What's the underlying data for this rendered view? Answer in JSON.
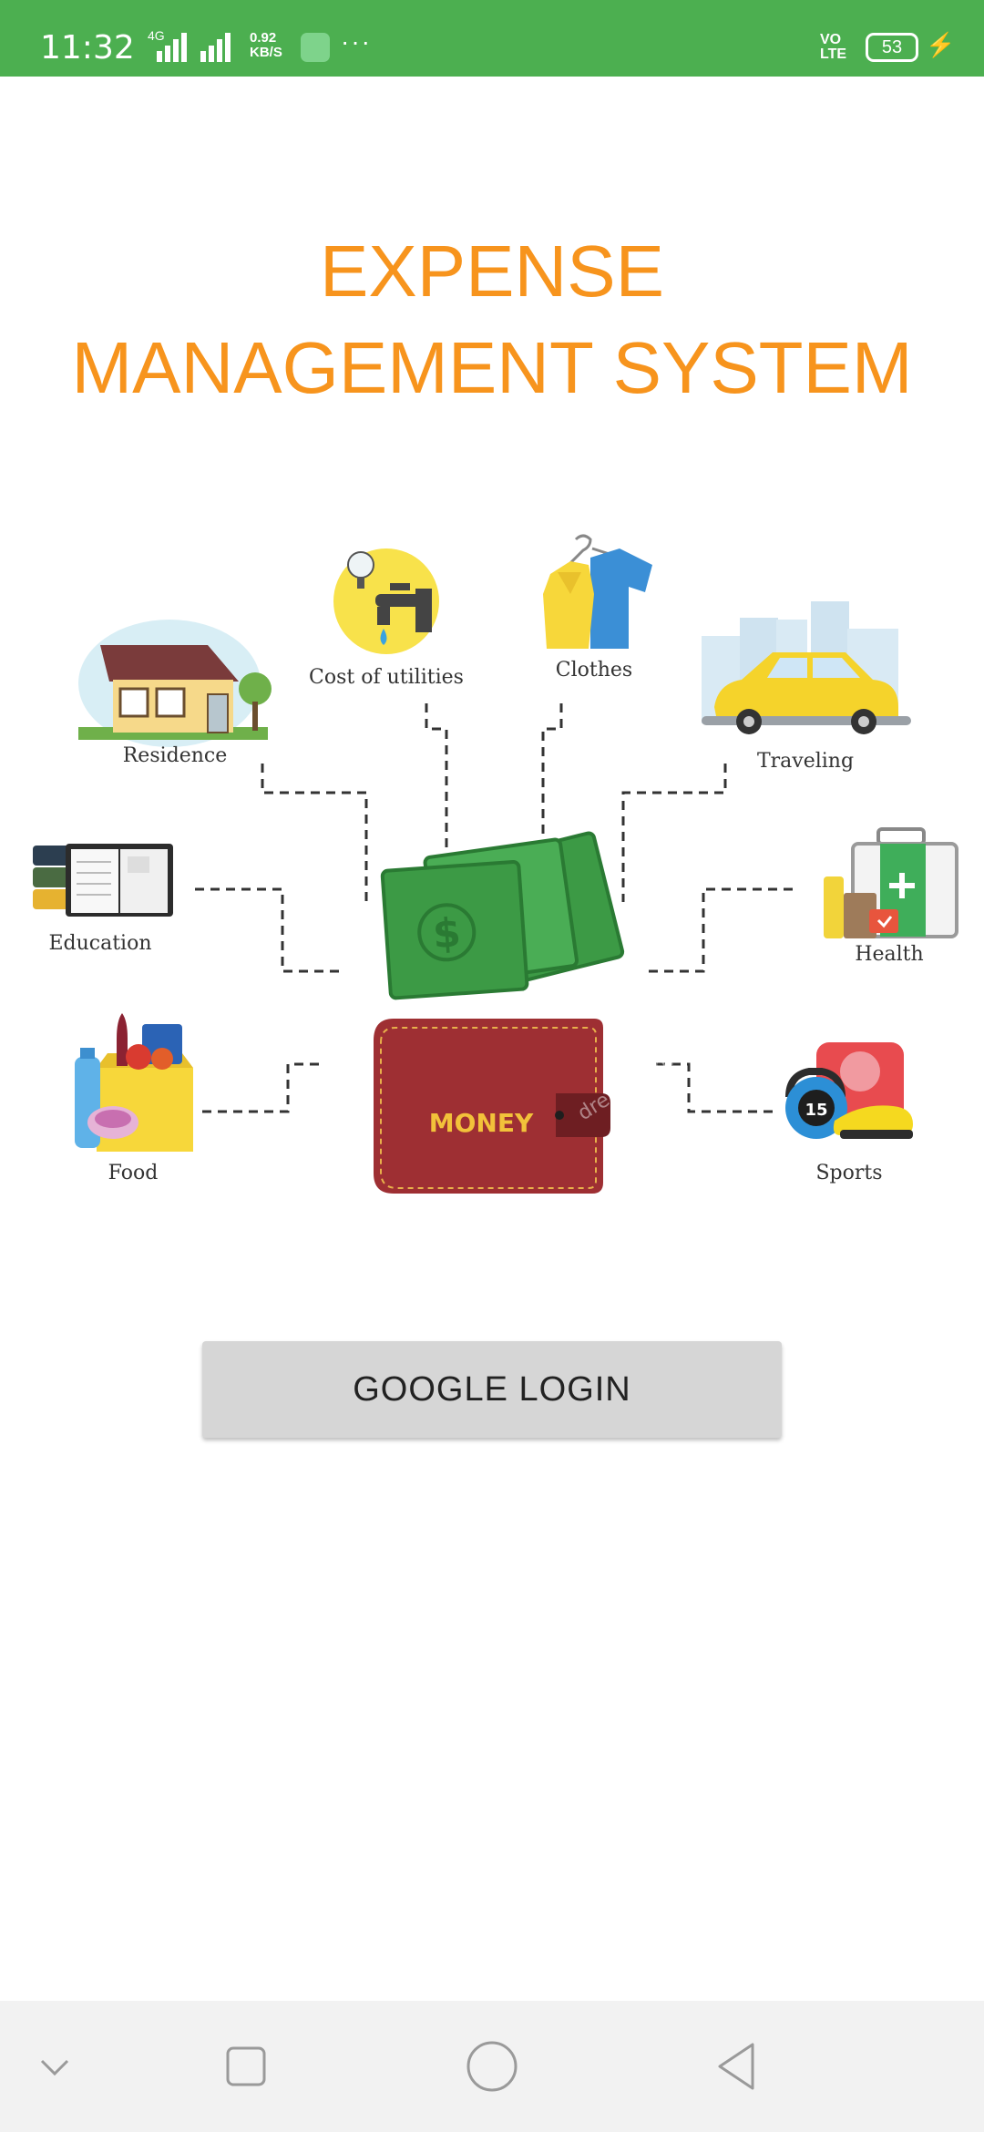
{
  "status_bar": {
    "time": "11:32",
    "network": "4G",
    "speed_value": "0.92",
    "speed_unit": "KB/S",
    "more": "···",
    "volte_1": "VO",
    "volte_2": "LTE",
    "battery": "53",
    "color": "#4caf50"
  },
  "title": {
    "line1": "EXPENSE",
    "line2": "MANAGEMENT SYSTEM",
    "color": "#f7941d"
  },
  "illustration": {
    "center_label": "MONEY",
    "watermark": "dreamstime",
    "categories": {
      "residence": "Residence",
      "utilities": "Cost of utilities",
      "clothes": "Clothes",
      "traveling": "Traveling",
      "education": "Education",
      "health": "Health",
      "food": "Food",
      "sports": "Sports"
    },
    "kettlebell_weight": "15"
  },
  "login": {
    "label": "GOOGLE LOGIN"
  },
  "nav": {
    "icons": [
      "chevron-down-icon",
      "recents-square-icon",
      "home-circle-icon",
      "back-triangle-icon"
    ]
  }
}
